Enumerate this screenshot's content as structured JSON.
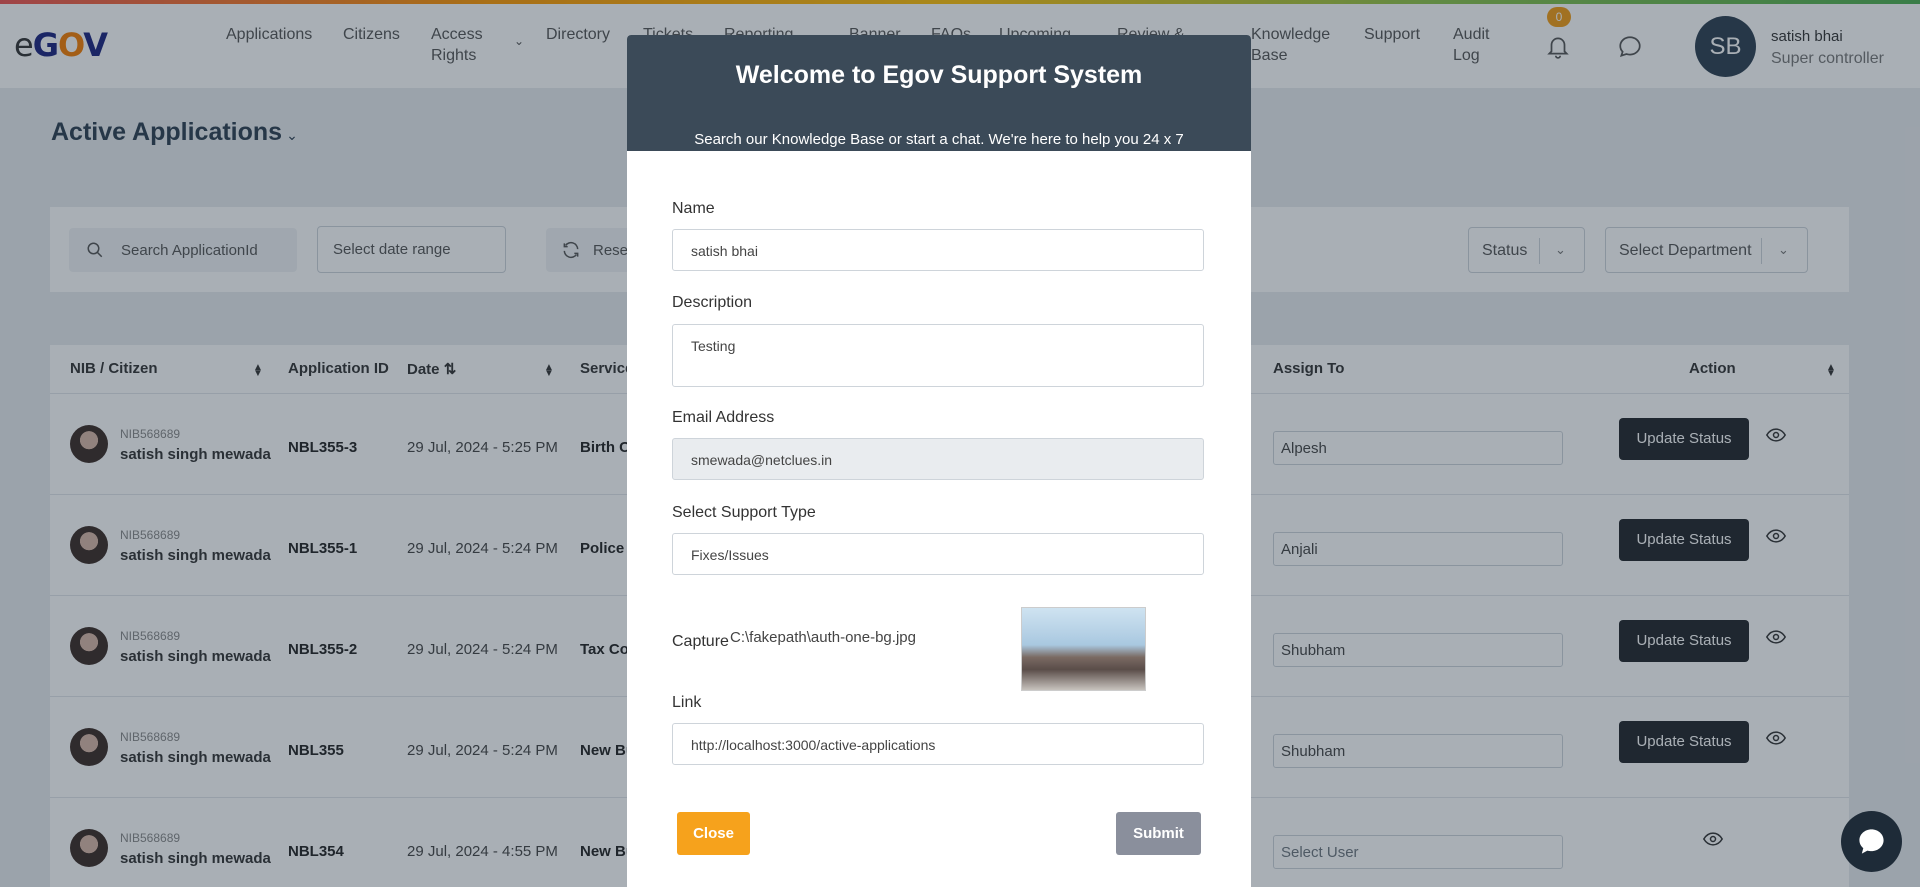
{
  "header": {
    "logo": {
      "e": "e",
      "g": "G",
      "o": "O",
      "v": "V"
    },
    "nav": [
      {
        "label": "Applications"
      },
      {
        "label": "Citizens"
      },
      {
        "label": "Access\nRights"
      },
      {
        "label": "Directory"
      },
      {
        "label": "Tickets"
      },
      {
        "label": "Reporting"
      },
      {
        "label": "Banner"
      },
      {
        "label": "FAQs"
      },
      {
        "label": "Upcoming"
      },
      {
        "label": "Review &"
      },
      {
        "label": "Knowledge\nBase"
      },
      {
        "label": "Support"
      },
      {
        "label": "Audit\nLog"
      }
    ],
    "notifications_count": "0",
    "user": {
      "initials": "SB",
      "name": "satish bhai",
      "role": "Super controller"
    }
  },
  "page": {
    "title": "Active Applications",
    "filters": {
      "search_placeholder": "Search ApplicationId",
      "date_placeholder": "Select date range",
      "reset_label": "Rese",
      "status_label": "Status",
      "department_label": "Select Department"
    }
  },
  "table": {
    "headers": {
      "citizen": "NIB / Citizen",
      "appid": "Application ID",
      "date": "Date",
      "service": "Service",
      "assign": "Assign To",
      "action": "Action"
    },
    "rows": [
      {
        "nib": "NIB568689",
        "citizen": "satish singh mewada",
        "appid": "NBL355-3",
        "date": "29 Jul, 2024 - 5:25 PM",
        "service": "Birth C",
        "assign": "Alpesh",
        "action": "Update Status"
      },
      {
        "nib": "NIB568689",
        "citizen": "satish singh mewada",
        "appid": "NBL355-1",
        "date": "29 Jul, 2024 - 5:24 PM",
        "service": "Police C",
        "assign": "Anjali",
        "action": "Update Status"
      },
      {
        "nib": "NIB568689",
        "citizen": "satish singh mewada",
        "appid": "NBL355-2",
        "date": "29 Jul, 2024 - 5:24 PM",
        "service": "Tax Co",
        "assign": "Shubham",
        "action": "Update Status"
      },
      {
        "nib": "NIB568689",
        "citizen": "satish singh mewada",
        "appid": "NBL355",
        "date": "29 Jul, 2024 - 5:24 PM",
        "service": "New Bu",
        "assign": "Shubham",
        "action": "Update Status"
      },
      {
        "nib": "NIB568689",
        "citizen": "satish singh mewada",
        "appid": "NBL354",
        "date": "29 Jul, 2024 - 4:55 PM",
        "service": "New Bu",
        "assign": "Select User",
        "action": ""
      }
    ]
  },
  "modal": {
    "title": "Welcome to Egov Support System",
    "subtitle": "Search our Knowledge Base or start a chat. We're here to help you 24 x 7",
    "name_label": "Name",
    "name_value": "satish bhai",
    "description_label": "Description",
    "description_value": "Testing",
    "email_label": "Email Address",
    "email_value": "smewada@netclues.in",
    "support_type_label": "Select Support Type",
    "support_type_value": "Fixes/Issues",
    "capture_label": "Capture",
    "capture_path": "C:\\fakepath\\auth-one-bg.jpg",
    "link_label": "Link",
    "link_value": "http://localhost:3000/active-applications",
    "close_label": "Close",
    "submit_label": "Submit"
  },
  "colors": {
    "modal_header": "#3b4a58",
    "close_button": "#f6a21c",
    "submit_button": "#8a8f9c",
    "update_button": "#212529",
    "badge": "#f39c12"
  },
  "icons": [
    "search-icon",
    "refresh-icon",
    "chevron-down-icon",
    "bell-icon",
    "chat-icon",
    "eye-icon",
    "sort-icon"
  ]
}
